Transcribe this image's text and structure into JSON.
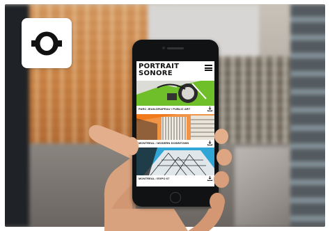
{
  "app": {
    "title": "PORTRAIT\nSONORE"
  },
  "cards": [
    {
      "caption": "PARC JEAN-DRAPEAU / PUBLIC ART",
      "accent": "#6fbf2a"
    },
    {
      "caption": "MONTREAL / MODERN DOWNTOWN",
      "accent": "#f07a1c"
    },
    {
      "caption": "MONTREAL / EXPO 67",
      "accent": "#2fa6d6"
    }
  ],
  "icons": {
    "logo": "portrait-sonore-logo-icon",
    "menu": "hamburger-menu-icon",
    "download": "download-icon"
  },
  "colors": {
    "logo_ring": "#111111",
    "card_green": "#6fbf2a",
    "card_orange": "#f07a1c",
    "card_blue": "#2fa6d6"
  }
}
